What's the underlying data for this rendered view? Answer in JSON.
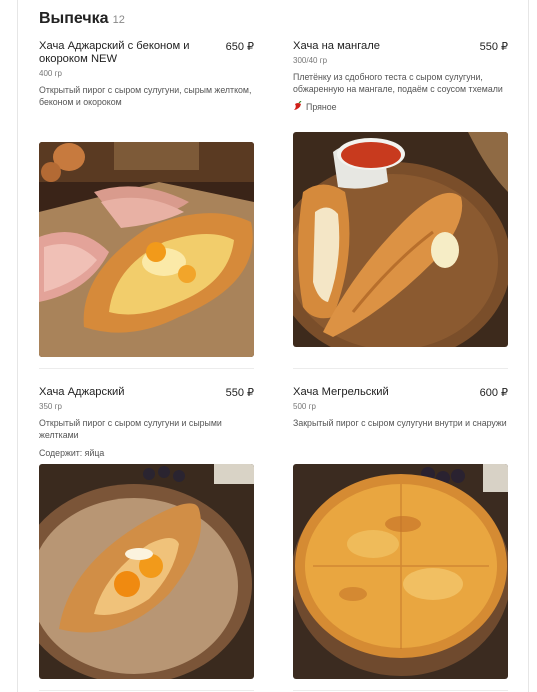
{
  "section": {
    "title": "Выпечка",
    "count": "12"
  },
  "items": [
    {
      "name": "Хача Аджарский с беконом и окороком NEW",
      "price": "650 ₽",
      "weight": "400 гр",
      "description": "Открытый пирог с сыром сулугуни, сырым желтком, беконом и окороком"
    },
    {
      "name": "Хача на мангале",
      "price": "550 ₽",
      "weight": "300/40 гр",
      "description": "Плетёнку из сдобного теста с сыром сулугуни, обжаренную на мангале, подаём с соусом тхемали",
      "tag": "Пряное",
      "tag_icon": "chili-pepper-icon"
    },
    {
      "name": "Хача Аджарский",
      "price": "550 ₽",
      "weight": "350 гр",
      "description": "Открытый пирог с сыром сулугуни и сырыми желтками",
      "contains": "Содержит: яйца"
    },
    {
      "name": "Хача Мегрельский",
      "price": "600 ₽",
      "weight": "500 гр",
      "description": "Закрытый пирог с сыром сулугуни внутри и снаружи"
    }
  ]
}
